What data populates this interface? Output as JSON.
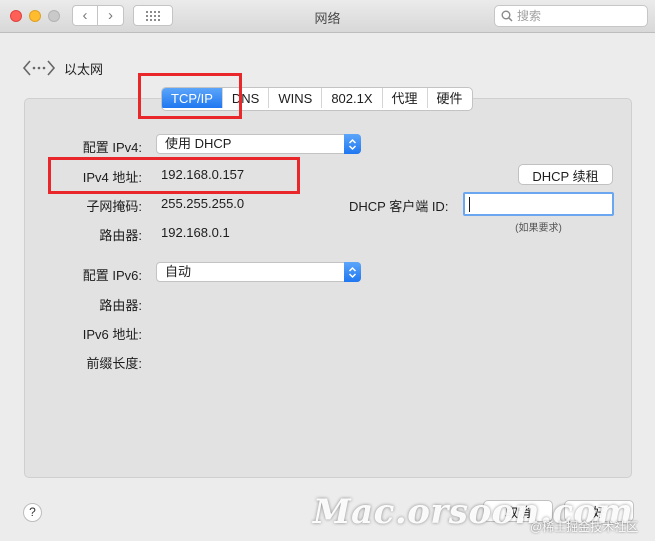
{
  "window": {
    "title": "网络"
  },
  "toolbar": {
    "back_glyph": "‹",
    "forward_glyph": "›",
    "search_placeholder": "搜索"
  },
  "service": {
    "name": "以太网",
    "icon": "ethernet-arrows-icon"
  },
  "tabs": [
    {
      "label": "TCP/IP",
      "active": true
    },
    {
      "label": "DNS",
      "active": false
    },
    {
      "label": "WINS",
      "active": false
    },
    {
      "label": "802.1X",
      "active": false
    },
    {
      "label": "代理",
      "active": false
    },
    {
      "label": "硬件",
      "active": false
    }
  ],
  "ipv4": {
    "config_label": "配置 IPv4:",
    "config_value": "使用 DHCP",
    "address_label": "IPv4 地址:",
    "address_value": "192.168.0.157",
    "subnet_label": "子网掩码:",
    "subnet_value": "255.255.255.0",
    "router_label": "路由器:",
    "router_value": "192.168.0.1"
  },
  "dhcp": {
    "renew_label": "DHCP 续租",
    "client_id_label": "DHCP 客户端 ID:",
    "client_id_value": "",
    "client_id_hint": "(如果要求)"
  },
  "ipv6": {
    "config_label": "配置 IPv6:",
    "config_value": "自动",
    "router_label": "路由器:",
    "address_label": "IPv6 地址:",
    "prefix_label": "前缀长度:"
  },
  "footer": {
    "help_label": "?",
    "cancel_label": "取消",
    "ok_label": "好"
  },
  "watermark": {
    "brand": "Mac.orsoon.com",
    "credit": "@稀土掘金技术社区"
  },
  "colors": {
    "accent": "#1f77f0",
    "highlight_box": "#e9262a"
  }
}
